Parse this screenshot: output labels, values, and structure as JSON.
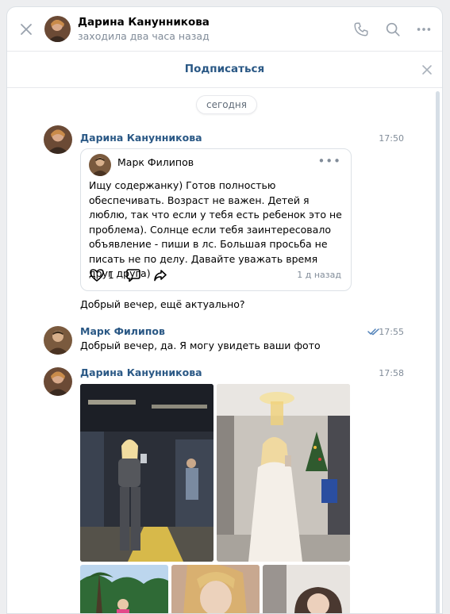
{
  "header": {
    "name": "Дарина Канунникова",
    "status": "заходила два часа назад"
  },
  "subscribe": {
    "label": "Подписаться"
  },
  "feed": {
    "date_chip": "сегодня",
    "messages": [
      {
        "sender": "Дарина Канунникова",
        "time": "17:50",
        "post": {
          "author": "Марк Филипов",
          "text": "Ищу содержанку) Готов полностью обеспечивать. Возраст не важен. Детей я люблю, так что если у тебя есть ребенок это не проблема). Солнце если тебя заинтересовало объявление - пиши в лс. Большая просьба не писать не по делу. Давайте уважать время друг друга)",
          "likes": "1",
          "date": "1 д назад"
        },
        "text": "Добрый вечер, ещё актуально?"
      },
      {
        "sender": "Марк Филипов",
        "time": "17:55",
        "text": "Добрый вечер, да. Я могу увидеть ваши фото"
      },
      {
        "sender": "Дарина Канунникова",
        "time": "17:58"
      }
    ]
  },
  "colors": {
    "link": "#2a5885",
    "secondary": "#818c99",
    "read_check": "#5181b8"
  },
  "icons": [
    "close-icon",
    "phone-icon",
    "search-icon",
    "more-icon",
    "heart-icon",
    "comment-icon",
    "share-icon",
    "read-check-icon"
  ]
}
